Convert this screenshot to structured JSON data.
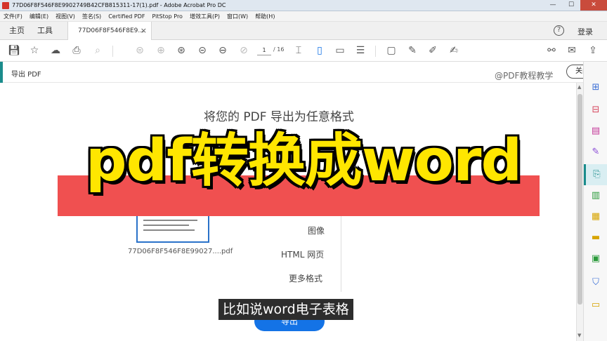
{
  "window": {
    "title": "77D06F8F546F8E9902749B42CFB815311-17(1).pdf - Adobe Acrobat Pro DC"
  },
  "menu": [
    "文件(F)",
    "编辑(E)",
    "视图(V)",
    "签名(S)",
    "Certified PDF",
    "PitStop Pro",
    "增效工具(P)",
    "窗口(W)",
    "帮助(H)"
  ],
  "tabs": {
    "home": "主页",
    "tools": "工具",
    "doc": "77D06F8F546F8E9...",
    "doc_close": "×"
  },
  "header": {
    "help": "?",
    "login": "登录"
  },
  "toolbar": {
    "page_current": "1",
    "page_total": "/ 16"
  },
  "panel": {
    "title": "导出 PDF",
    "close_label": "关闭",
    "watermark": "@PDF教程教学"
  },
  "export": {
    "heading": "将您的 PDF 导出为任意格式",
    "file_label": "77D06F8F546F8E99027....pdf",
    "formats": [
      "图像",
      "HTML 网页",
      "更多格式"
    ],
    "export_button": "导出"
  },
  "overlay": {
    "banner": "pdf转换成word",
    "subtitle": "比如说word电子表格"
  },
  "colors": {
    "accent": "#1a8c8c",
    "primary_button": "#1473e6",
    "banner_text": "#ffe600",
    "banner_red": "#f05050"
  }
}
